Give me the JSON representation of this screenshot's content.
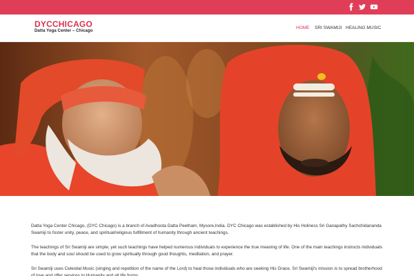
{
  "topbar": {
    "color": "#e03e58",
    "social_icons": [
      "facebook-icon",
      "twitter-icon",
      "youtube-icon"
    ]
  },
  "header": {
    "site_title": "DYCCHICAGO",
    "site_subtitle": "Datta Yoga Center – Chicago",
    "nav": [
      {
        "label": "HOME",
        "active": true
      },
      {
        "label": "SRI SWAMIJI",
        "active": false
      },
      {
        "label": "HEALING MUSIC",
        "active": false
      }
    ],
    "accent_color": "#d9334f"
  },
  "hero": {
    "image": "photo-two-swamijis-in-orange-robes"
  },
  "content": {
    "paragraphs": [
      "Datta Yoga Center Chicago, (DYC Chicago) is a branch of Avadhoota Datta Peetham, Mysore,India. DYC Chicago was established by His Holiness Sri Ganapathy Sachchidananda Swamiji to foster unity, peace, and spiritual/religious fulfillment of humanity through ancient teachings.",
      "The teachings of Sri Swamiji are simple, yet such teachings have helped numerous individuals to experience the true meaning of life. One of the main teachings instructs individuals that the body and soul should be used to grow spiritually through good thoughts, meditation, and prayer.",
      "Sri Swamiji uses Celestial Music (singing and repetition of the name of the Lord) to heal those individuals who are seeking His Grace. Sri Swamiji's mission is to spread brotherhood of love and offer services to Humanity and all life forms ."
    ]
  }
}
